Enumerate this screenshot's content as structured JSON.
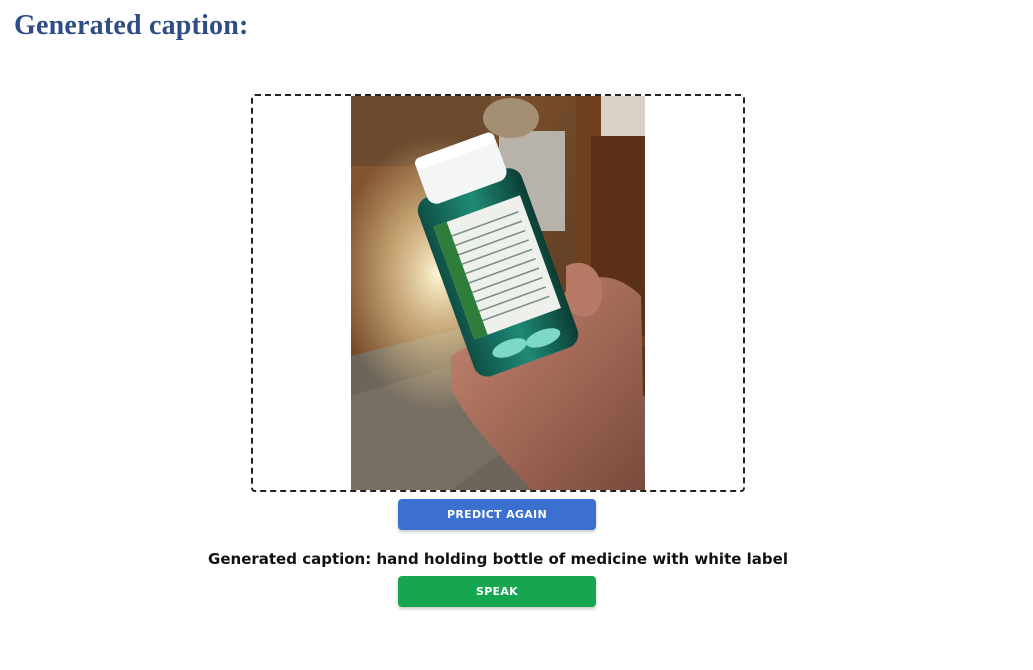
{
  "page": {
    "title": "Generated caption:"
  },
  "actions": {
    "predict_again_label": "PREDICT AGAIN",
    "speak_label": "SPEAK"
  },
  "result": {
    "caption_prefix": "Generated caption:",
    "caption_text": "hand holding bottle of medicine with white label"
  },
  "colors": {
    "title": "#2f4d85",
    "predict_button": "#3b70d0",
    "speak_button": "#16a650"
  }
}
